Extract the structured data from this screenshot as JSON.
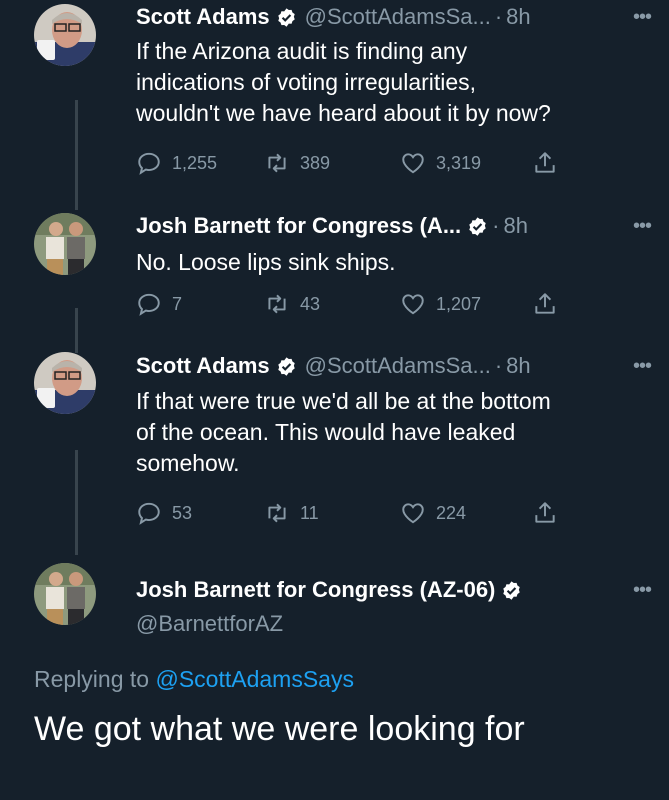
{
  "tweets": [
    {
      "name": "Scott Adams",
      "handle": "@ScottAdamsSa...",
      "dot": "·",
      "time": "8h",
      "text_lines": [
        "If the Arizona audit is finding any",
        "indications of voting irregularities,",
        "wouldn't we have heard about it by now?"
      ],
      "replies": "1,255",
      "retweets": "389",
      "likes": "3,319"
    },
    {
      "name": "Josh Barnett for Congress (A...",
      "handle": "",
      "dot": "·",
      "time": "8h",
      "text_lines": [
        "No. Loose lips sink ships."
      ],
      "replies": "7",
      "retweets": "43",
      "likes": "1,207"
    },
    {
      "name": "Scott Adams",
      "handle": "@ScottAdamsSa...",
      "dot": "·",
      "time": "8h",
      "text_lines": [
        "If that were true we'd all be at the bottom",
        "of the ocean. This would have leaked",
        "somehow."
      ],
      "replies": "53",
      "retweets": "11",
      "likes": "224"
    }
  ],
  "main_tweet": {
    "name": "Josh Barnett for Congress (AZ-06)",
    "handle": "@BarnettforAZ",
    "replying_prefix": "Replying to",
    "replying_to": "@ScottAdamsSays",
    "text": "We got what we were looking for"
  },
  "icons": {
    "verified": "verified-badge-icon",
    "more": "more-dots-icon",
    "reply": "reply-icon",
    "retweet": "retweet-icon",
    "like": "heart-icon",
    "share": "share-icon"
  },
  "colors": {
    "background": "#15202b",
    "secondary_text": "#8899a6",
    "link": "#1da1f2",
    "thread_line": "#38444d"
  }
}
